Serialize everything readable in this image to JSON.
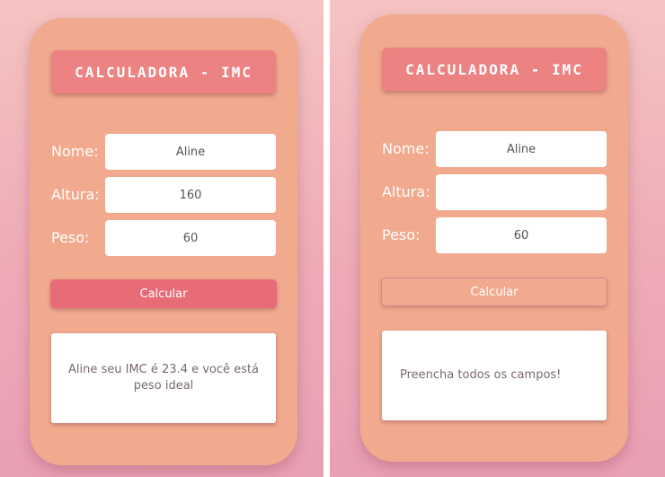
{
  "left": {
    "title": "CALCULADORA - IMC",
    "name_label": "Nome:",
    "height_label": "Altura:",
    "weight_label": "Peso:",
    "name_value": "Aline",
    "height_value": "160",
    "weight_value": "60",
    "button_label": "Calcular",
    "result_text": "Aline seu IMC é 23.4 e você está peso ideal"
  },
  "right": {
    "title": "CALCULADORA - IMC",
    "name_label": "Nome:",
    "height_label": "Altura:",
    "weight_label": "Peso:",
    "name_value": "Aline",
    "height_value": "",
    "weight_value": "60",
    "button_label": "Calcular",
    "result_text": "Preencha todos os campos!"
  },
  "colors": {
    "card": "#f1aa8e",
    "title_bg": "#ec8282",
    "button_active": "#e86c78",
    "background_top": "#f5c4c2",
    "background_bottom": "#e99fb4"
  }
}
